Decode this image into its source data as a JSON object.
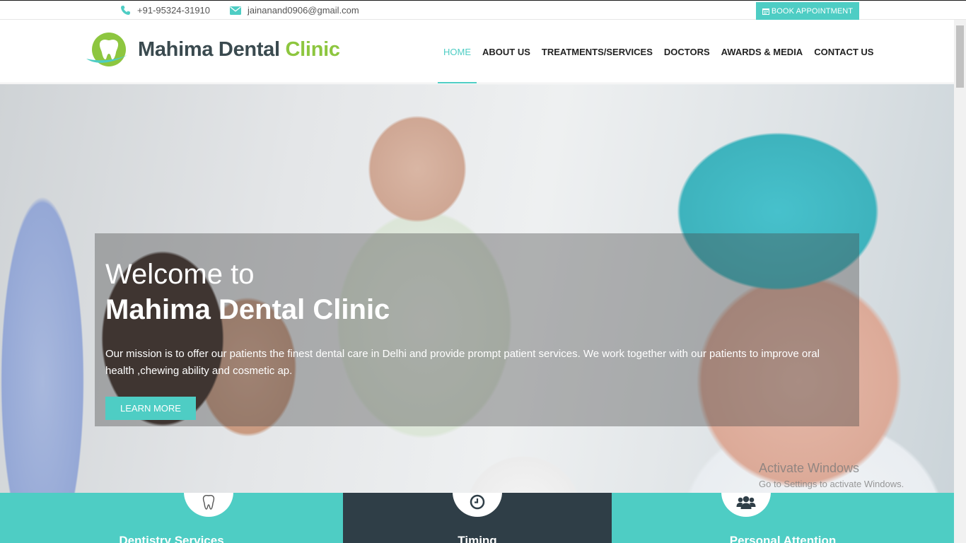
{
  "topbar": {
    "phone": "+91-95324-31910",
    "email": "jainanand0906@gmail.com",
    "book_label": "BOOK APPOINTMENT",
    "phone_icon": "phone-icon",
    "email_icon": "envelope-icon",
    "calendar_icon": "calendar-icon"
  },
  "header": {
    "logo_main": "Mahima Dental",
    "logo_accent": "Clinic",
    "nav": [
      {
        "label": "HOME",
        "active": true
      },
      {
        "label": "ABOUT US"
      },
      {
        "label": "TREATMENTS/SERVICES"
      },
      {
        "label": "DOCTORS"
      },
      {
        "label": "AWARDS & MEDIA"
      },
      {
        "label": "CONTACT US"
      }
    ]
  },
  "hero": {
    "welcome": "Welcome to",
    "title": "Mahima Dental Clinic",
    "text": "Our mission is to offer our patients the finest dental care in Delhi and provide prompt patient services. We work together with our patients to improve oral health ,chewing ability and cosmetic ap.",
    "button": "LEARN MORE"
  },
  "watermark": {
    "line1": "Activate Windows",
    "line2": "Go to Settings to activate Windows."
  },
  "features": [
    {
      "title": "Dentistry Services",
      "icon": "tooth-icon"
    },
    {
      "title": "Timing",
      "icon": "clock-icon"
    },
    {
      "title": "Personal Attention",
      "icon": "users-icon"
    }
  ],
  "colors": {
    "accent": "#4ecdc4",
    "logo_green": "#8dc63f",
    "dark": "#2f3e47"
  }
}
